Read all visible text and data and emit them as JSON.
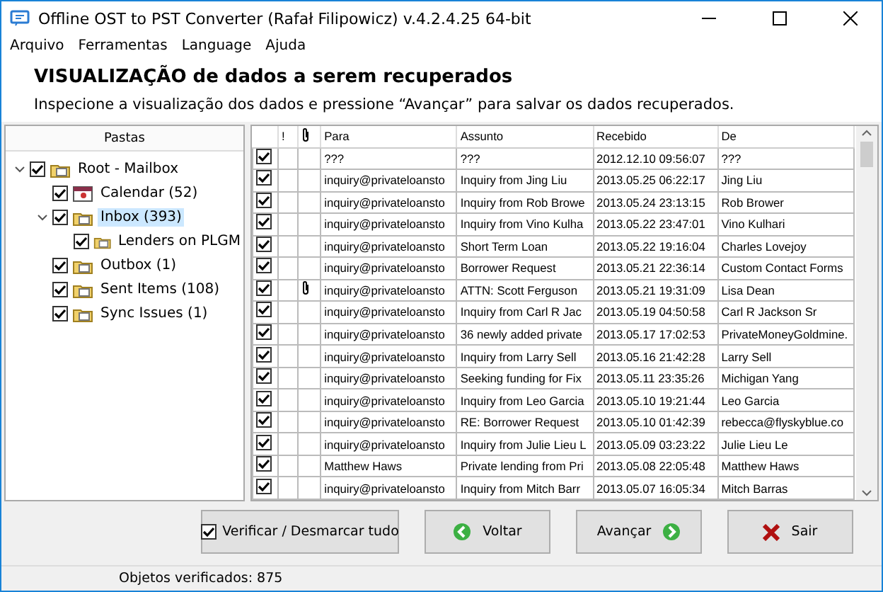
{
  "window": {
    "title": "Offline OST to PST Converter (Rafał Filipowicz) v.4.2.4.25 64-bit"
  },
  "menu": [
    "Arquivo",
    "Ferramentas",
    "Language",
    "Ajuda"
  ],
  "header": {
    "title": "VISUALIZAÇÃO de dados a serem recuperados",
    "subtitle": "Inspecione a visualização dos dados e pressione “Avançar” para salvar os dados recuperados."
  },
  "folders": {
    "title": "Pastas",
    "tree": [
      {
        "label": "Root - Mailbox",
        "kind": "mailbox",
        "checked": true,
        "expanded": true,
        "selected": false,
        "children": [
          {
            "label": "Calendar",
            "count": "(52)",
            "kind": "calendar",
            "checked": true,
            "selected": false
          },
          {
            "label": "Inbox",
            "count": "(393)",
            "kind": "folder",
            "checked": true,
            "expanded": true,
            "selected": true,
            "children": [
              {
                "label": "Lenders on PLGM",
                "kind": "folder",
                "checked": true,
                "selected": false
              }
            ]
          },
          {
            "label": "Outbox",
            "count": "(1)",
            "kind": "folder",
            "checked": true,
            "selected": false
          },
          {
            "label": "Sent Items",
            "count": "(108)",
            "kind": "folder",
            "checked": true,
            "selected": false
          },
          {
            "label": "Sync Issues",
            "count": "(1)",
            "kind": "folder",
            "checked": true,
            "selected": false
          }
        ]
      }
    ]
  },
  "table": {
    "columns": [
      "!",
      "Para",
      "Assunto",
      "Recebido",
      "De"
    ],
    "rows": [
      {
        "checked": true,
        "attachment": false,
        "to": "???",
        "subject": "???",
        "received": "2012.12.10 09:56:07",
        "from": "???"
      },
      {
        "checked": true,
        "attachment": false,
        "to": "inquiry@privateloansto",
        "subject": "Inquiry from Jing Liu",
        "received": "2013.05.25 06:22:17",
        "from": "Jing Liu"
      },
      {
        "checked": true,
        "attachment": false,
        "to": "inquiry@privateloansto",
        "subject": "Inquiry from Rob Browe",
        "received": "2013.05.24 23:13:15",
        "from": "Rob Brower"
      },
      {
        "checked": true,
        "attachment": false,
        "to": "inquiry@privateloansto",
        "subject": "Inquiry from Vino Kulha",
        "received": "2013.05.22 23:47:01",
        "from": "Vino Kulhari"
      },
      {
        "checked": true,
        "attachment": false,
        "to": "inquiry@privateloansto",
        "subject": "Short Term Loan",
        "received": "2013.05.22 19:16:04",
        "from": "Charles Lovejoy"
      },
      {
        "checked": true,
        "attachment": false,
        "to": "inquiry@privateloansto",
        "subject": "Borrower Request",
        "received": "2013.05.21 22:36:14",
        "from": "Custom Contact Forms"
      },
      {
        "checked": true,
        "attachment": true,
        "to": "inquiry@privateloansto",
        "subject": "ATTN:  Scott Ferguson",
        "received": "2013.05.21 19:31:09",
        "from": "Lisa Dean"
      },
      {
        "checked": true,
        "attachment": false,
        "to": "inquiry@privateloansto",
        "subject": "Inquiry from Carl R Jac",
        "received": "2013.05.19 04:50:58",
        "from": "Carl R Jackson Sr"
      },
      {
        "checked": true,
        "attachment": false,
        "to": "inquiry@privateloansto",
        "subject": "36 newly added private",
        "received": "2013.05.17 17:02:53",
        "from": "PrivateMoneyGoldmine."
      },
      {
        "checked": true,
        "attachment": false,
        "to": "inquiry@privateloansto",
        "subject": "Inquiry from Larry Sell",
        "received": "2013.05.16 21:42:28",
        "from": "Larry Sell"
      },
      {
        "checked": true,
        "attachment": false,
        "to": "inquiry@privateloansto",
        "subject": "Seeking funding for Fix",
        "received": "2013.05.11 23:35:26",
        "from": "Michigan Yang"
      },
      {
        "checked": true,
        "attachment": false,
        "to": "inquiry@privateloansto",
        "subject": "Inquiry from Leo Garcia",
        "received": "2013.05.10 19:21:44",
        "from": "Leo Garcia"
      },
      {
        "checked": true,
        "attachment": false,
        "to": "inquiry@privateloansto",
        "subject": "RE: Borrower Request",
        "received": "2013.05.10 01:42:39",
        "from": "rebecca@flyskyblue.co"
      },
      {
        "checked": true,
        "attachment": false,
        "to": "inquiry@privateloansto",
        "subject": "Inquiry from Julie Lieu L",
        "received": "2013.05.09 03:23:22",
        "from": "Julie Lieu Le"
      },
      {
        "checked": true,
        "attachment": false,
        "to": "Matthew Haws",
        "subject": "Private lending from Pri",
        "received": "2013.05.08 22:05:48",
        "from": "Matthew Haws"
      },
      {
        "checked": true,
        "attachment": false,
        "to": "inquiry@privateloansto",
        "subject": "Inquiry from Mitch Barr",
        "received": "2013.05.07 16:05:34",
        "from": "Mitch Barras"
      }
    ]
  },
  "buttons": [
    {
      "label": "Verificar / Desmarcar tudo",
      "kind": "checkall",
      "checked": true
    },
    {
      "label": "Voltar",
      "kind": "back"
    },
    {
      "label": "Avançar",
      "kind": "next"
    },
    {
      "label": "Sair",
      "kind": "exit"
    }
  ],
  "status_bar": "Objetos verificados: 875"
}
